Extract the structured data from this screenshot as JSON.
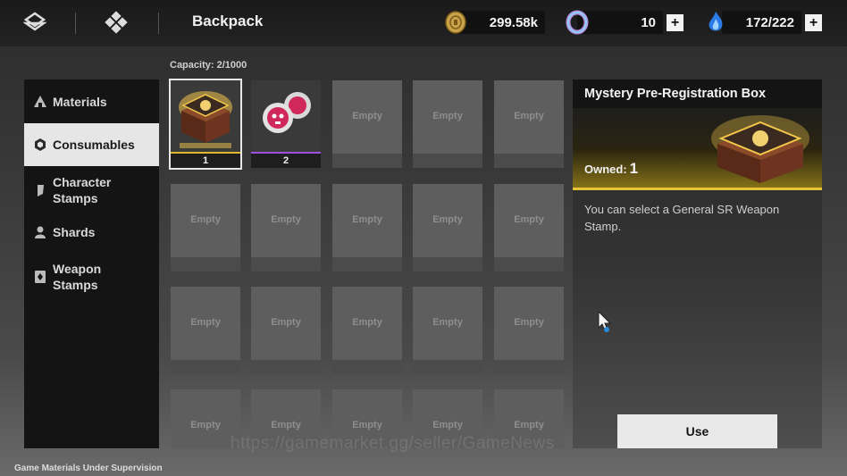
{
  "header": {
    "title": "Backpack",
    "currencies": [
      {
        "name": "gold-coin",
        "value": "299.58k"
      },
      {
        "name": "ring-token",
        "value": "10"
      },
      {
        "name": "blue-flame-stamina",
        "value": "172/222"
      }
    ]
  },
  "capacity": "Capacity: 2/1000",
  "sidebar": {
    "items": [
      {
        "label": "Materials",
        "icon": "materials-icon"
      },
      {
        "label": "Consumables",
        "icon": "hexagon-icon",
        "active": true
      },
      {
        "label": "Character Stamps",
        "line1": "Character",
        "line2": "Stamps",
        "icon": "character-stamp-icon"
      },
      {
        "label": "Shards",
        "icon": "person-icon"
      },
      {
        "label": "Weapon Stamps",
        "line1": "Weapon",
        "line2": "Stamps",
        "icon": "weapon-stamp-icon"
      }
    ]
  },
  "grid": {
    "items": [
      {
        "count": "1",
        "rarity": "gold",
        "art": "mystery-box-icon"
      },
      {
        "count": "2",
        "rarity": "purple",
        "art": "red-orbs-icon"
      }
    ],
    "empty_label": "Empty"
  },
  "detail": {
    "title": "Mystery Pre-Registration Box",
    "owned_label": "Owned:",
    "owned_count": "1",
    "description": "You can select a General SR Weapon Stamp."
  },
  "use_label": "Use",
  "watermark": "https://gamemarket.gg/seller/GameNews",
  "footer": "Game Materials Under Supervision",
  "colors": {
    "accent_gold": "#e8c43a",
    "accent_purple": "#a050e0",
    "panel_dark": "#141414"
  }
}
